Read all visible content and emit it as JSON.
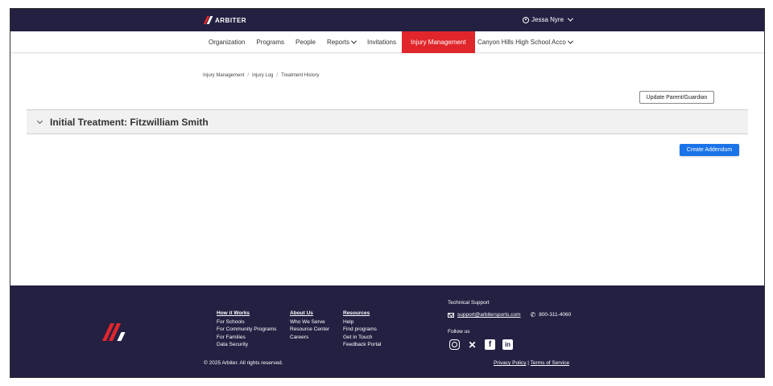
{
  "header": {
    "logo_text": "ARBITER",
    "user_name": "Jessa Nyre"
  },
  "nav": {
    "items": [
      "Organization",
      "Programs",
      "People",
      "Reports",
      "Invitations",
      "Injury Management"
    ],
    "active_index": 5,
    "school": "Canyon Hills High School Acco"
  },
  "breadcrumb": [
    "Injury Management",
    "Injury Log",
    "Treatment History"
  ],
  "buttons": {
    "update_guardian": "Update Parent/Guardian",
    "create_addendum": "Create Addendum"
  },
  "section": {
    "title": "Initial Treatment: Fitzwilliam Smith"
  },
  "footer": {
    "col1": {
      "heading": "How it Works",
      "links": [
        "For Schools",
        "For Community Programs",
        "For Families",
        "Data Security"
      ]
    },
    "col2": {
      "heading": "About Us",
      "links": [
        "Who We Serve",
        "Resource Center",
        "Careers"
      ]
    },
    "col3": {
      "heading": "Resources",
      "links": [
        "Help",
        "Find programs",
        "Get in Touch",
        "Feedback Portal"
      ]
    },
    "support_label": "Technical Support",
    "email": "support@arbitersports.com",
    "phone": "800-311-4060",
    "follow_label": "Follow us",
    "copyright": "© 2025 Arbiter. All rights reserved.",
    "privacy": "Privacy Policy",
    "terms": "Terms of Service",
    "divider": "|"
  },
  "colors": {
    "navy": "#232042",
    "red": "#e0262b",
    "blue": "#1a73e8"
  }
}
